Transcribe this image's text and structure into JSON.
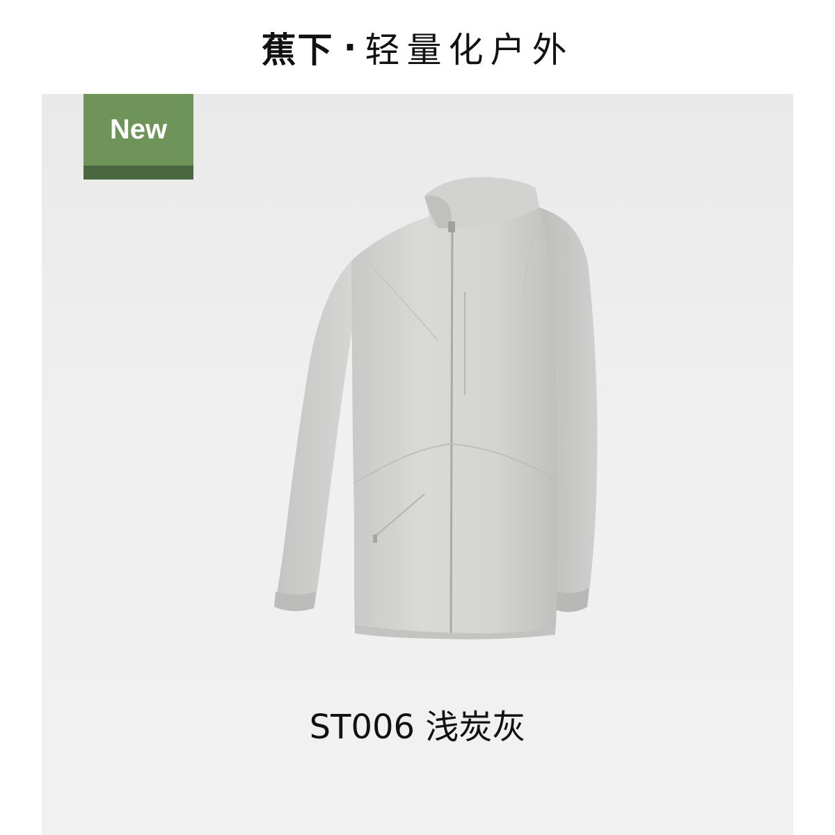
{
  "header": {
    "brand": "蕉下",
    "separator": "·",
    "slogan": "轻量化户外"
  },
  "badge": {
    "label": "New",
    "color": "#6f9459",
    "stripe_color": "#4a6740"
  },
  "product": {
    "caption": "ST006 浅炭灰",
    "image_subject": "light gray stand-collar zip jacket"
  }
}
